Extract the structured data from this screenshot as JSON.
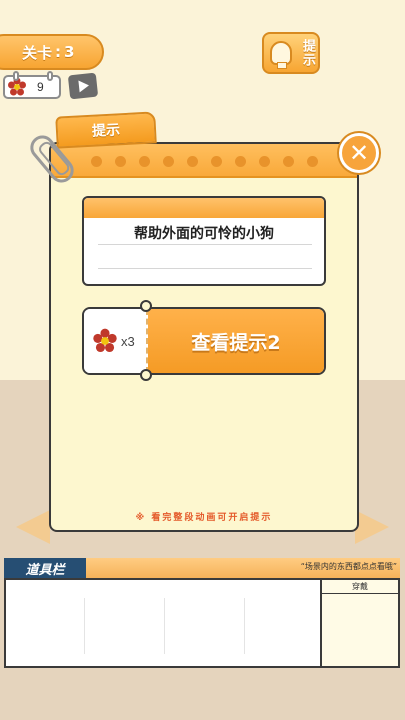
{
  "level": {
    "label": "关卡",
    "sep": ":",
    "number": "3"
  },
  "flowers": {
    "count": "9",
    "icon": "flower-icon"
  },
  "video_button": {
    "icon": "video-play-icon"
  },
  "hint_button": {
    "label": "提示",
    "icon": "lightbulb-icon"
  },
  "modal": {
    "tab_label": "提示",
    "close_icon": "close-icon",
    "hint_text": "帮助外面的可怜的小狗",
    "reveal": {
      "cost": "x3",
      "button_label": "查看提示2",
      "icon": "flower-icon"
    },
    "note": "※ 看完整段动画可开启提示"
  },
  "item_bar": {
    "title": "道具栏",
    "tip": "“场景内的东西都点点看哦”",
    "wear_label": "穿戴"
  },
  "colors": {
    "accent_orange": "#f7a532",
    "navy": "#264e73",
    "wall": "#fbf3d8",
    "floor": "#e5d4bd",
    "warning_red": "#e45a2a"
  }
}
